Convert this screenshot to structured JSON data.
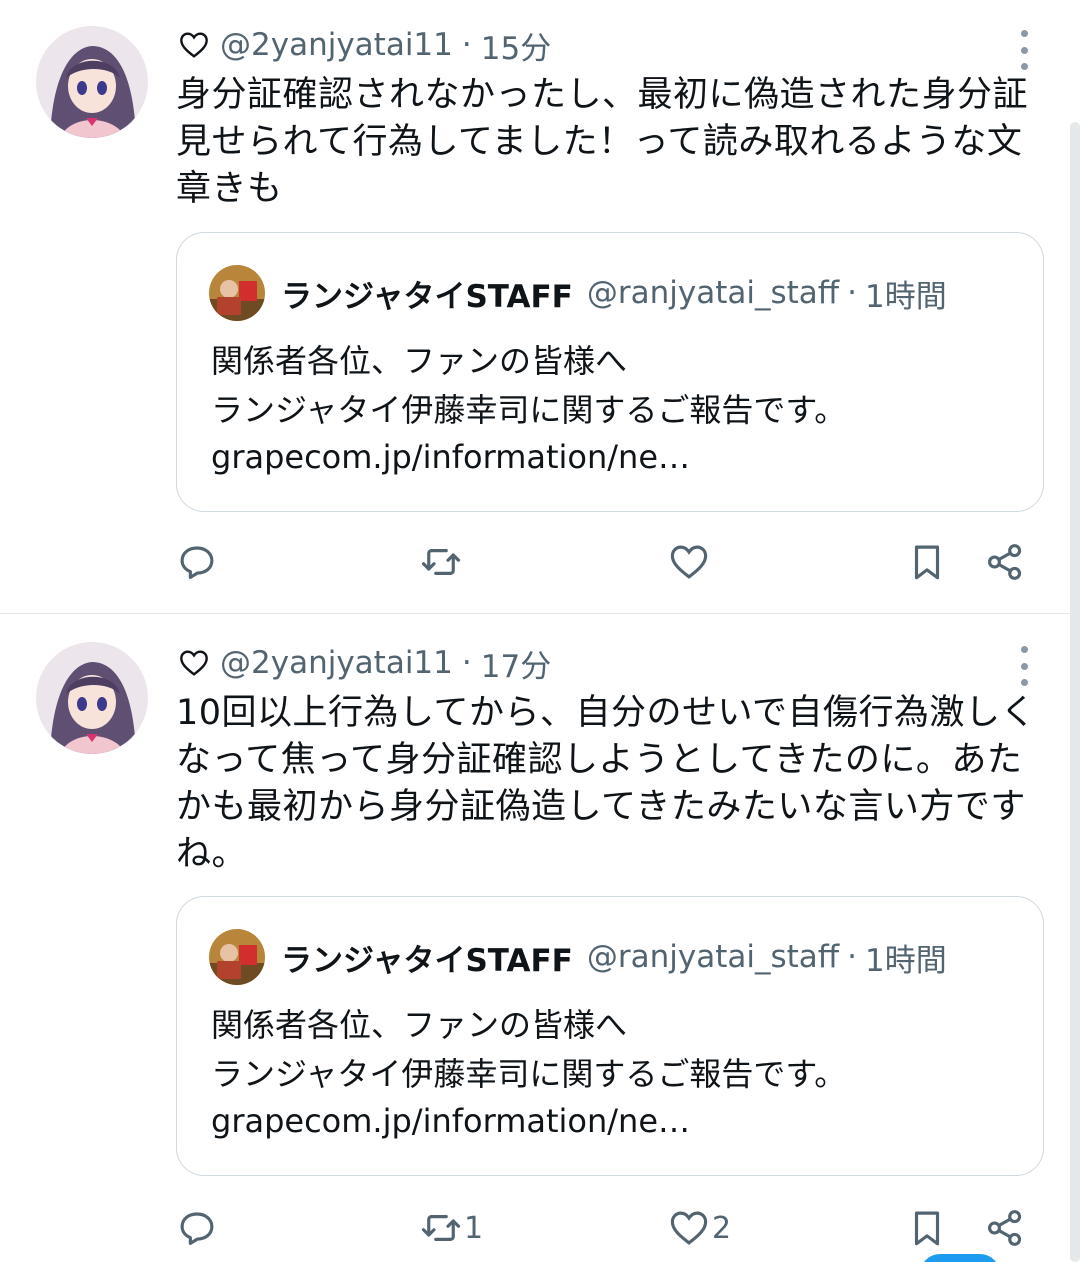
{
  "tweets": [
    {
      "handle": "@2yanjyatai11",
      "separator": "·",
      "time": "15分",
      "lines": [
        "身分証確認されなかったし、最初に偽造された身分証",
        "見せられて行為してました！って読み取れるような文",
        "章きも"
      ],
      "quote": {
        "name": "ランジャタイSTAFF",
        "handle": "@ranjyatai_staff",
        "separator": "·",
        "time": "1時間",
        "line1": "関係者各位、ファンの皆様へ",
        "line2": "ランジャタイ伊藤幸司に関するご報告です。",
        "link": "grapecom.jp/information/ne…"
      },
      "counts": {
        "reply": "",
        "retweet": "",
        "like": ""
      }
    },
    {
      "handle": "@2yanjyatai11",
      "separator": "·",
      "time": "17分",
      "lines": [
        "10回以上行為してから、自分のせいで自傷行為激しく",
        "なって焦って身分証確認しようとしてきたのに。あた",
        "かも最初から身分証偽造してきたみたいな言い方です",
        "ね。"
      ],
      "quote": {
        "name": "ランジャタイSTAFF",
        "handle": "@ranjyatai_staff",
        "separator": "·",
        "time": "1時間",
        "line1": "関係者各位、ファンの皆様へ",
        "line2": "ランジャタイ伊藤幸司に関するご報告です。",
        "link": "grapecom.jp/information/ne…"
      },
      "counts": {
        "reply": "",
        "retweet": "1",
        "like": "2"
      }
    }
  ],
  "icons": [
    "heart-icon",
    "more-icon",
    "reply-icon",
    "retweet-icon",
    "like-icon",
    "bookmark-icon",
    "share-icon"
  ],
  "colors": {
    "text": "#0f1419",
    "secondary": "#536471",
    "border": "#cfd9de",
    "accent": "#1d9bf0"
  }
}
